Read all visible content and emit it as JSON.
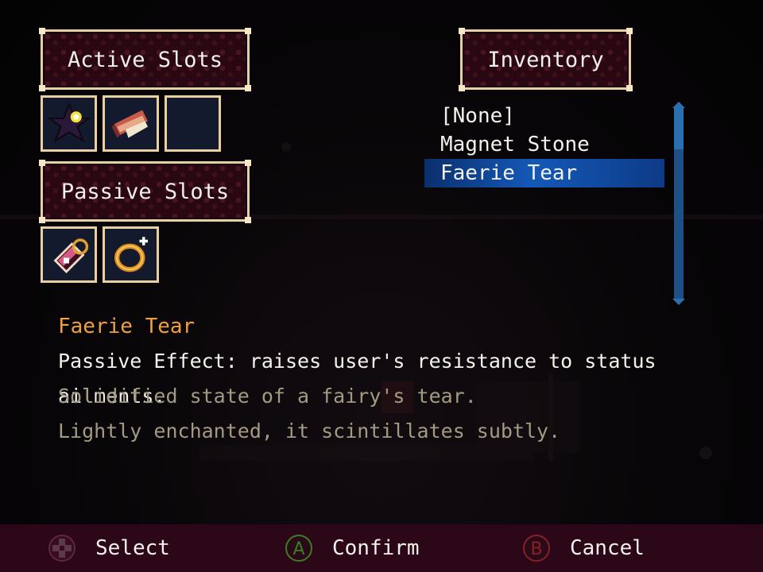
{
  "panels": {
    "active_title": "Active Slots",
    "passive_title": "Passive Slots",
    "inventory_title": "Inventory"
  },
  "active_slots": [
    {
      "icon": "dark-star-bomb-icon"
    },
    {
      "icon": "scroll-letter-icon"
    },
    {
      "icon": "empty"
    }
  ],
  "passive_slots": [
    {
      "icon": "crystal-bottle-icon"
    },
    {
      "icon": "gold-ring-icon"
    }
  ],
  "inventory": {
    "items": [
      "[None]",
      "Magnet Stone",
      "Faerie Tear"
    ],
    "selected_index": 2,
    "scroll_fraction": 0.0
  },
  "description": {
    "name": "Faerie Tear",
    "effect": "Passive Effect: raises user's resistance to status ailments.",
    "flavor_1": "Solidified state of a fairy's tear.",
    "flavor_2": "Lightly enchanted, it scintillates subtly."
  },
  "controls": {
    "select": "Select",
    "confirm": "Confirm",
    "cancel": "Cancel",
    "confirm_button": "A",
    "cancel_button": "B"
  },
  "colors": {
    "panel_border": "#e9cfa2",
    "panel_fill": "#2a0812",
    "highlight": "#1459b8",
    "item_name": "#f0a040",
    "flavor_text": "#a39a82",
    "control_bar": "#2c0718",
    "confirm_ring": "#3f7a2a",
    "cancel_ring": "#8a1f2a"
  }
}
